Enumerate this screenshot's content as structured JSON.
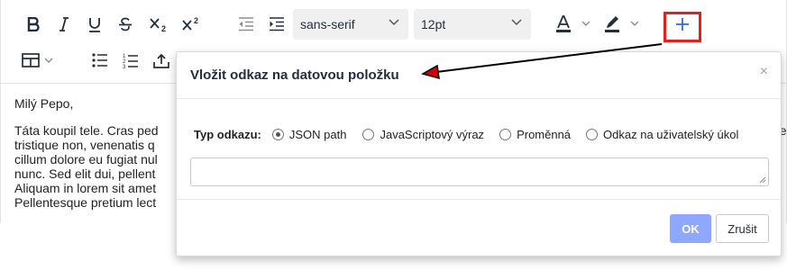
{
  "toolbar": {
    "font_family": "sans-serif",
    "font_size": "12pt",
    "icons": [
      "bold-icon",
      "italic-icon",
      "underline-icon",
      "strikethrough-icon",
      "subscript-icon",
      "superscript-icon",
      "outdent-icon",
      "indent-icon",
      "text-color-icon",
      "highlight-color-icon",
      "plus-icon",
      "table-icon",
      "bullet-list-icon",
      "numbered-list-icon",
      "upload-icon"
    ]
  },
  "content": {
    "greeting": "Milý Pepo,",
    "lines": [
      "Táta koupil tele. Cras ped",
      "tristique non, venenatis q",
      "cillum dolore eu fugiat nul",
      "nunc. Sed elit dui, pellent",
      "Aliquam in lorem sit amet",
      "Pellentesque pretium lect"
    ],
    "right_fragment": "ge"
  },
  "dialog": {
    "title": "Vložit odkaz na datovou položku",
    "close_symbol": "×",
    "link_type_label": "Typ odkazu:",
    "options": [
      "JSON path",
      "JavaScriptový výraz",
      "Proměnná",
      "Odkaz na uživatelský úkol"
    ],
    "selected_option": "JSON path",
    "input_value": "",
    "ok_label": "OK",
    "cancel_label": "Zrušit"
  },
  "colors": {
    "highlight_box": "#e51e1e",
    "ok_button": "#8fa8ff",
    "plus_icon": "#2d6fd1",
    "arrow": "#000000",
    "arrow_head": "#cc0000"
  }
}
